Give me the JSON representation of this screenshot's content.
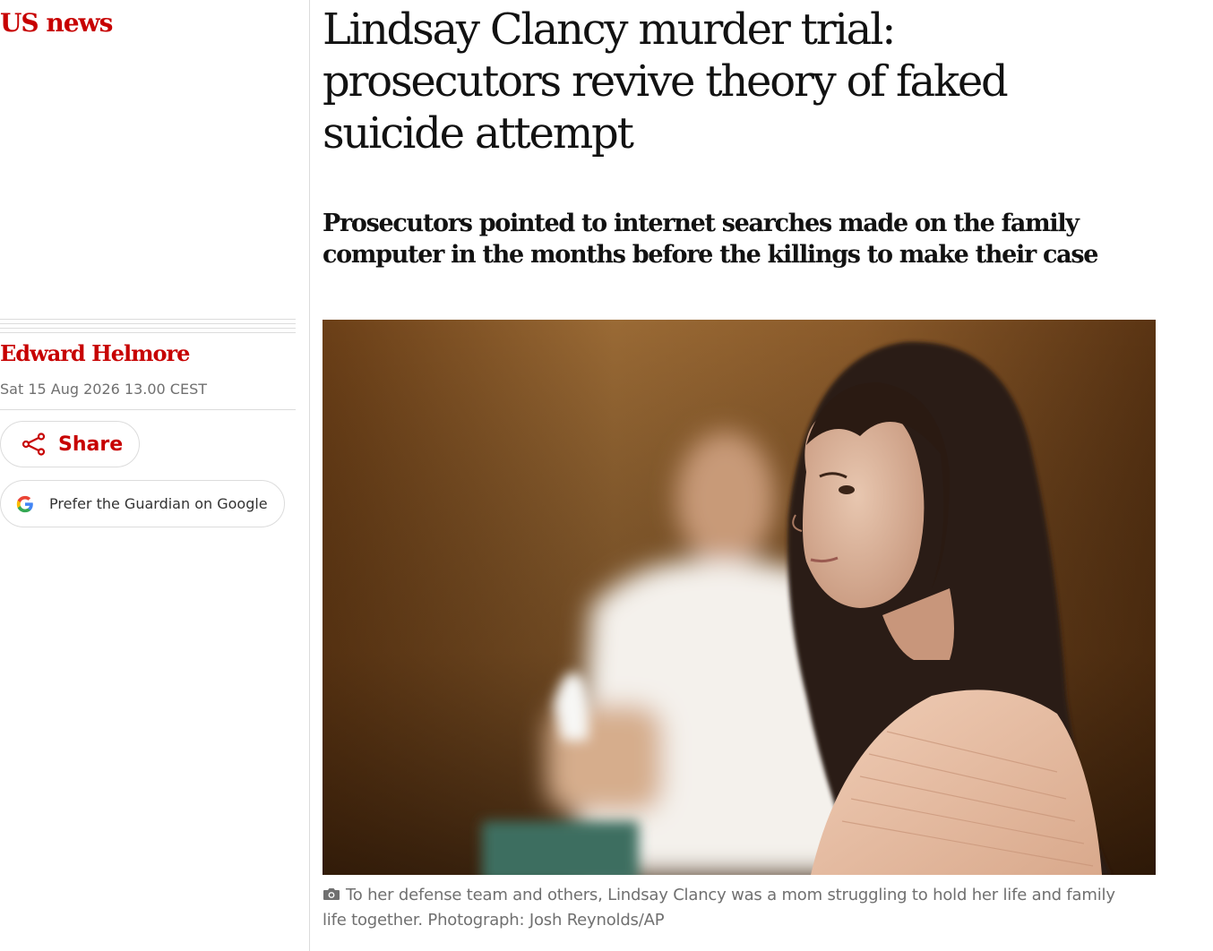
{
  "section": {
    "label": "US news"
  },
  "article": {
    "headline": "Lindsay Clancy murder trial: prosecutors revive theory of faked suicide attempt",
    "standfirst": "Prosecutors pointed to internet searches made on the family computer in the months before the killings to make their case",
    "byline": "Edward Helmore",
    "dateline": "Sat 15 Aug 2026 13.00 CEST",
    "caption": "To her defense team and others, Lindsay Clancy was a mom struggling to hold her life and family life together. Photograph: Josh Reynolds/AP"
  },
  "actions": {
    "share_label": "Share",
    "share_icon": "share-icon",
    "google_label": "Prefer the Guardian on Google",
    "google_icon": "google-g-icon"
  },
  "colors": {
    "accent": "#c70000",
    "text": "#121212",
    "muted": "#707070",
    "rule": "#dcdcdc"
  },
  "icons": {
    "caption_icon": "camera-icon"
  }
}
